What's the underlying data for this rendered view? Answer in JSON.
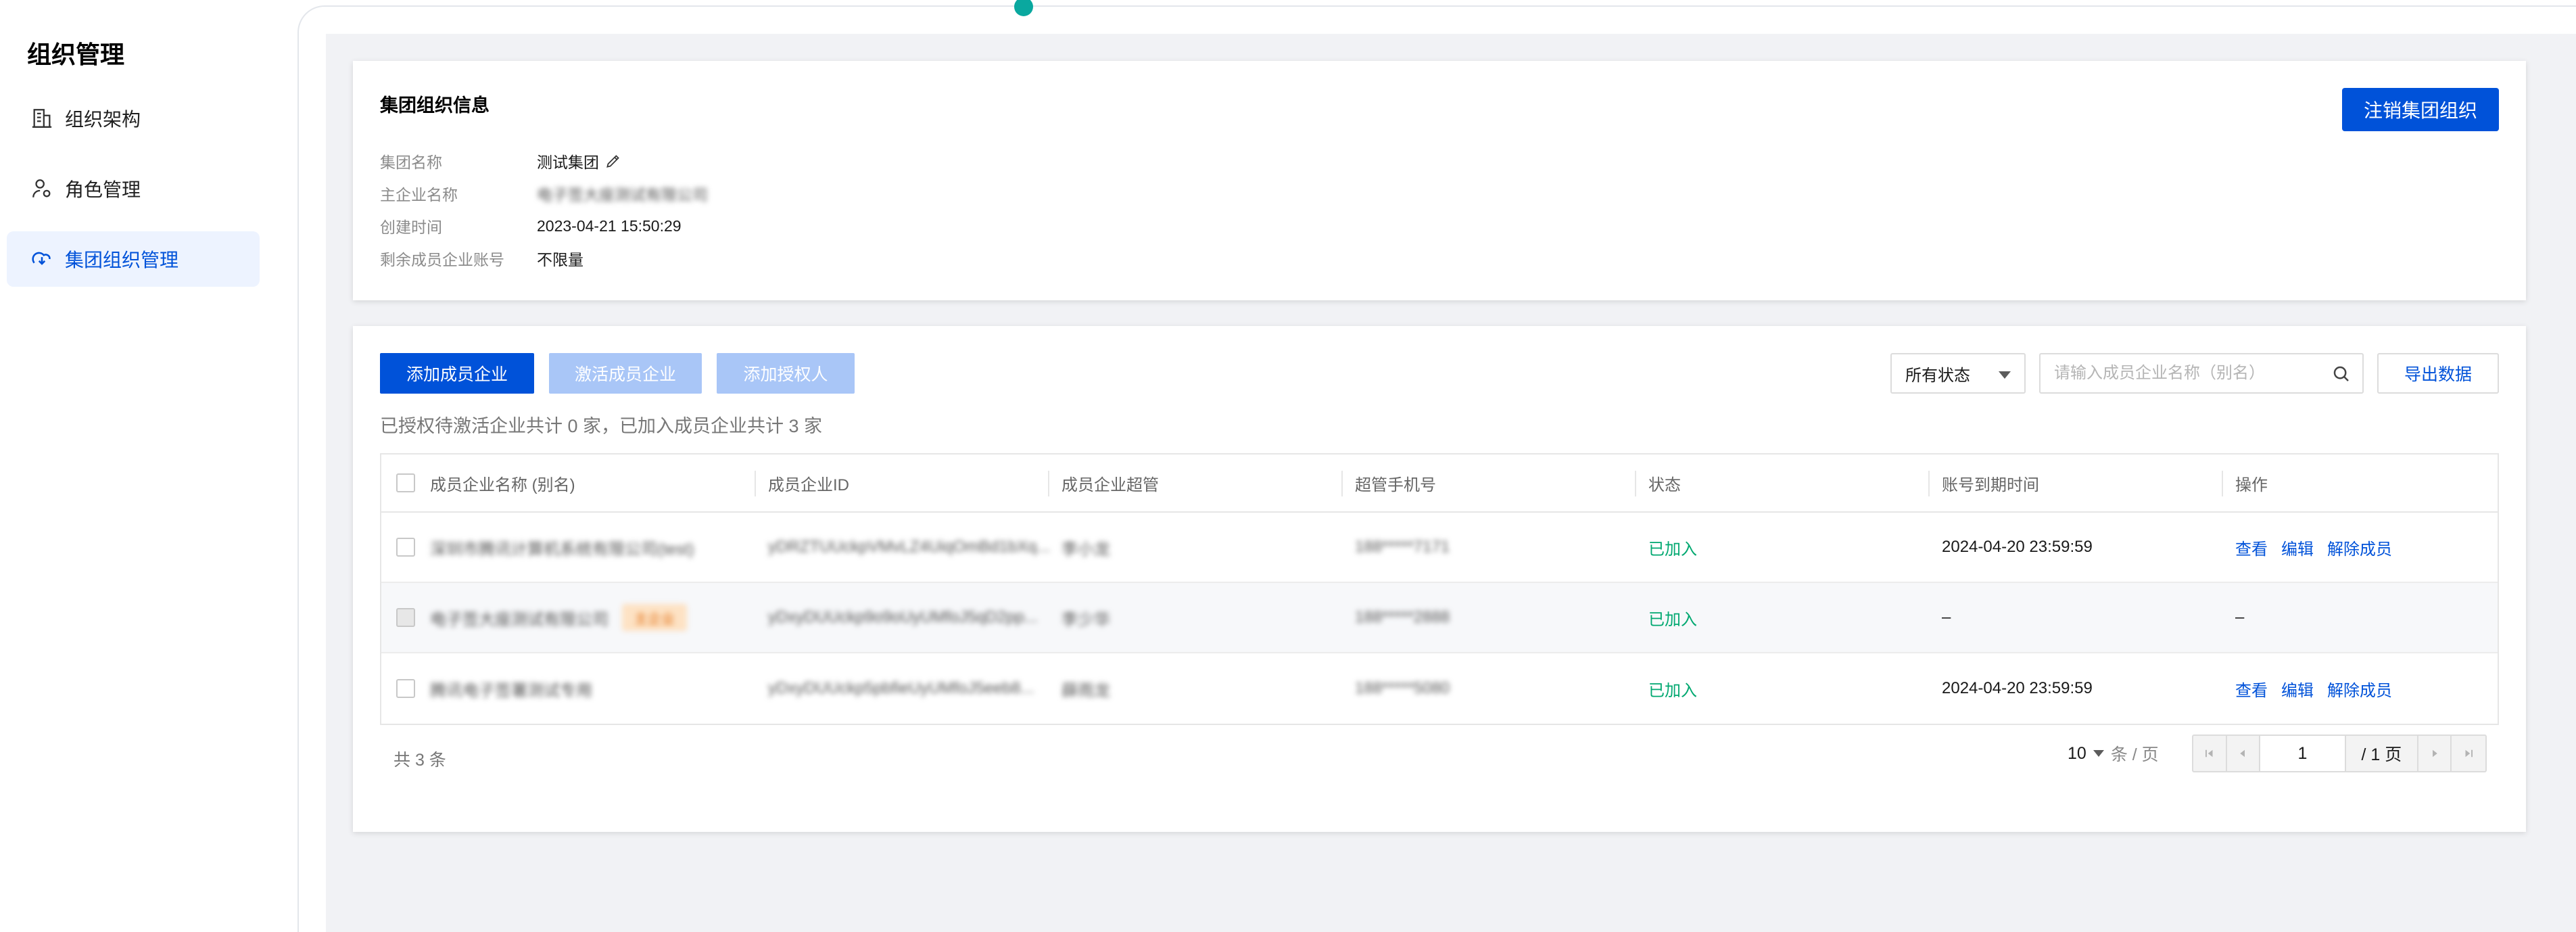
{
  "sidebar": {
    "title": "组织管理",
    "items": [
      {
        "label": "组织架构",
        "icon": "building-icon",
        "active": false
      },
      {
        "label": "角色管理",
        "icon": "user-settings-icon",
        "active": false
      },
      {
        "label": "集团组织管理",
        "icon": "org-cloud-icon",
        "active": true
      }
    ]
  },
  "info": {
    "title": "集团组织信息",
    "dissolve_label": "注销集团组织",
    "rows": [
      {
        "label": "集团名称",
        "value": "测试集团"
      },
      {
        "label": "主企业名称",
        "value": "电子签大座测试有限公司"
      },
      {
        "label": "创建时间",
        "value": "2023-04-21 15:50:29"
      },
      {
        "label": "剩余成员企业账号",
        "value": "不限量"
      }
    ]
  },
  "toolbar": {
    "add_label": "添加成员企业",
    "activate_label": "激活成员企业",
    "grant_label": "添加授权人",
    "status_filter": "所有状态",
    "search_placeholder": "请输入成员企业名称（别名）",
    "export_label": "导出数据"
  },
  "summary": "已授权待激活企业共计 0 家，已加入成员企业共计 3 家",
  "table": {
    "headers": [
      "成员企业名称 (别名)",
      "成员企业ID",
      "成员企业超管",
      "超管手机号",
      "状态",
      "账号到期时间",
      "操作"
    ],
    "rows": [
      {
        "name": "深圳市腾讯计算机系统有限公司(test)",
        "tag": "",
        "id": "yDRZTUUckpVMvLZ4UiqOmBd1bXq...",
        "admin": "李小龙",
        "phone": "188*****7171",
        "status": "已加入",
        "expire": "2024-04-20 23:59:59",
        "ops": [
          "查看",
          "编辑",
          "解除成员"
        ]
      },
      {
        "name": "电子签大座测试有限公司",
        "tag": "主企业",
        "id": "yDxyDUUckp9o9oUyUMfoJ5qD2pp...",
        "admin": "李少华",
        "phone": "188*****2888",
        "status": "已加入",
        "expire": "–",
        "ops": [
          "–"
        ]
      },
      {
        "name": "腾讯电子签署测试专用",
        "tag": "",
        "id": "yDxyDUUckp5pbfieUyUMfoJ5eeb8...",
        "admin": "薛雨龙",
        "phone": "188*****5080",
        "status": "已加入",
        "expire": "2024-04-20 23:59:59",
        "ops": [
          "查看",
          "编辑",
          "解除成员"
        ]
      }
    ]
  },
  "footer": {
    "total": "共 3 条",
    "page_size": "10",
    "page_size_unit": "条 / 页",
    "current_page": "1",
    "page_total": "/ 1 页"
  },
  "colors": {
    "primary": "#0052d9",
    "primary_disabled": "#a9c6f7",
    "success": "#00a870",
    "tag_bg": "#fde2c4",
    "tag_text": "#e37318"
  }
}
